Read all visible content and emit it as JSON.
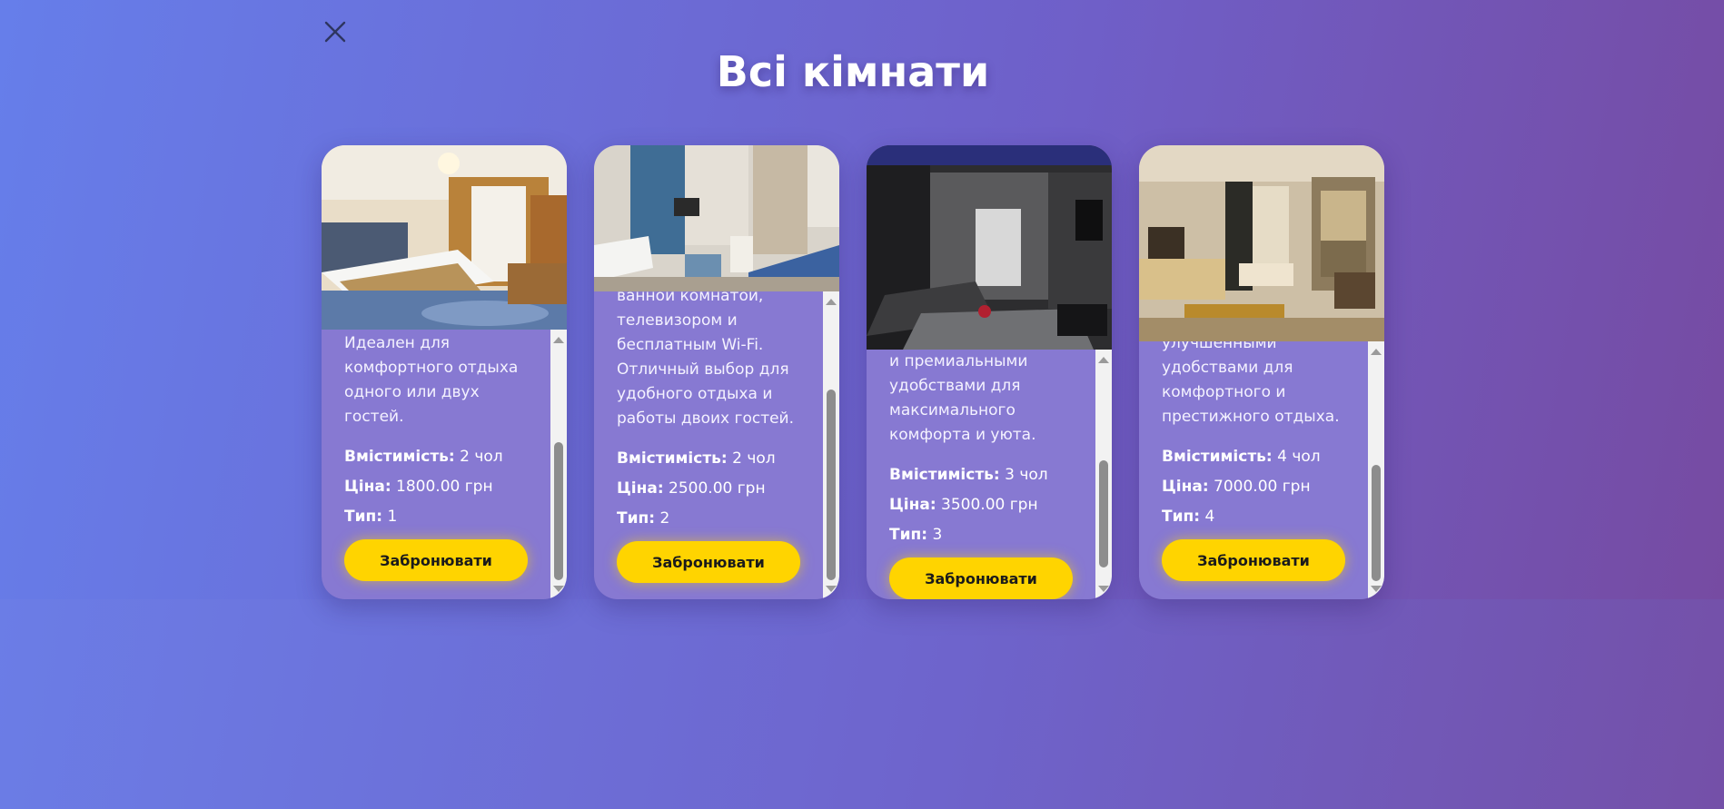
{
  "page": {
    "title": "Всі кімнати"
  },
  "colors": {
    "background_start": "#667eea",
    "background_end": "#764ba2",
    "card": "#8779d2",
    "button": "#ffd400",
    "button_text": "#1b1b1b"
  },
  "close_icon": "close-icon",
  "rooms": [
    {
      "description": "бесплатным Wi-Fi. Идеален для комфортного отдыха одного или двух гостей.",
      "capacity_label": "Вмістимість:",
      "capacity_value": "2 чол",
      "price_label": "Ціна:",
      "price_value": "1800.00 грн",
      "type_label": "Тип:",
      "type_value": "1",
      "book_label": "Забронювати",
      "scroll_fraction": 0.87
    },
    {
      "description": "ванной комнатой, телевизором и бесплатным Wi-Fi. Отличный выбор для удобного отдыха и работы двоих гостей.",
      "capacity_label": "Вмістимість:",
      "capacity_value": "2 чол",
      "price_label": "Ціна:",
      "price_value": "2500.00 грн",
      "type_label": "Тип:",
      "type_value": "2",
      "book_label": "Забронювати",
      "scroll_fraction": 0.9
    },
    {
      "description": "и премиальными удобствами для максимального комфорта и уюта.",
      "capacity_label": "Вмістимість:",
      "capacity_value": "3 чол",
      "price_label": "Ціна:",
      "price_value": "3500.00 грн",
      "type_label": "Тип:",
      "type_value": "3",
      "book_label": "Забронювати",
      "scroll_fraction": 0.95
    },
    {
      "description": "улучшенными удобствами для комфортного и престижного отдыха.",
      "capacity_label": "Вмістимість:",
      "capacity_value": "4 чол",
      "price_label": "Ціна:",
      "price_value": "7000.00 грн",
      "type_label": "Тип:",
      "type_value": "4",
      "book_label": "Забронювати",
      "scroll_fraction": 0.92
    }
  ]
}
